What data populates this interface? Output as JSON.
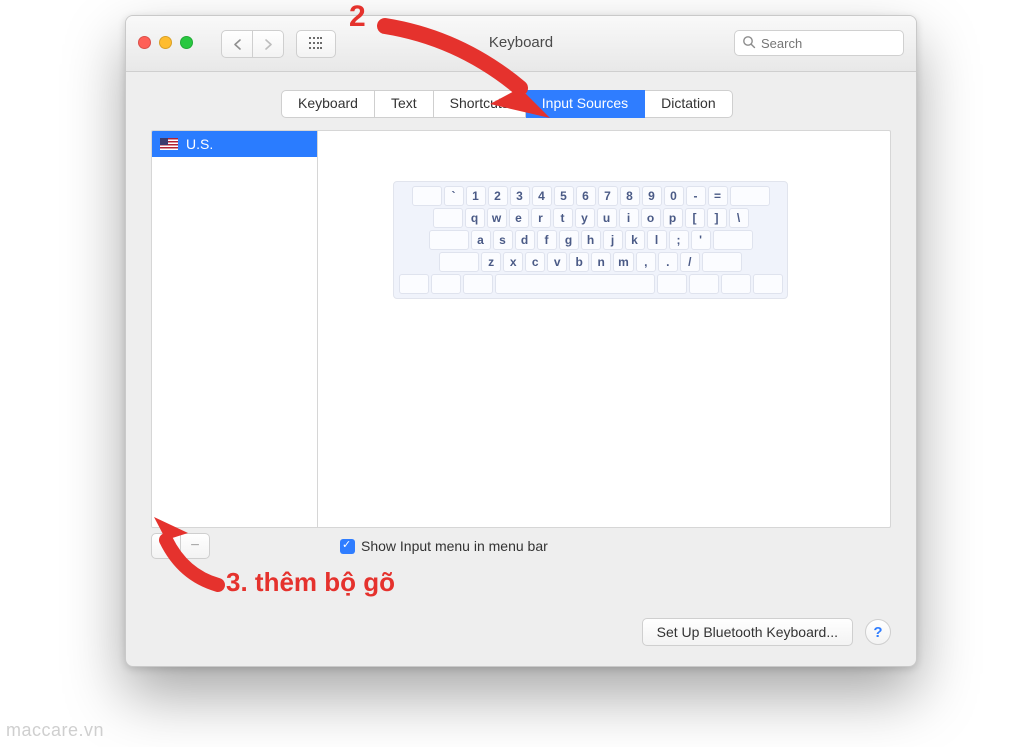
{
  "window": {
    "title": "Keyboard"
  },
  "search": {
    "placeholder": "Search"
  },
  "tabs": [
    {
      "label": "Keyboard"
    },
    {
      "label": "Text"
    },
    {
      "label": "Shortcuts"
    },
    {
      "label": "Input Sources"
    },
    {
      "label": "Dictation"
    }
  ],
  "active_tab": "Input Sources",
  "sources": [
    {
      "label": "U.S.",
      "flag": "us"
    }
  ],
  "keyboard_rows": [
    [
      "`",
      "1",
      "2",
      "3",
      "4",
      "5",
      "6",
      "7",
      "8",
      "9",
      "0",
      "-",
      "="
    ],
    [
      "q",
      "w",
      "e",
      "r",
      "t",
      "y",
      "u",
      "i",
      "o",
      "p",
      "[",
      "]",
      "\\"
    ],
    [
      "a",
      "s",
      "d",
      "f",
      "g",
      "h",
      "j",
      "k",
      "l",
      ";",
      "'"
    ],
    [
      "z",
      "x",
      "c",
      "v",
      "b",
      "n",
      "m",
      ",",
      ".",
      "/"
    ]
  ],
  "checkbox": {
    "label": "Show Input menu in menu bar",
    "checked": true
  },
  "buttons": {
    "bluetooth": "Set Up Bluetooth Keyboard...",
    "add": "+",
    "remove": "−"
  },
  "annotations": {
    "num2": "2",
    "step3": "3. thêm bộ gõ"
  },
  "watermark": "maccare.vn"
}
